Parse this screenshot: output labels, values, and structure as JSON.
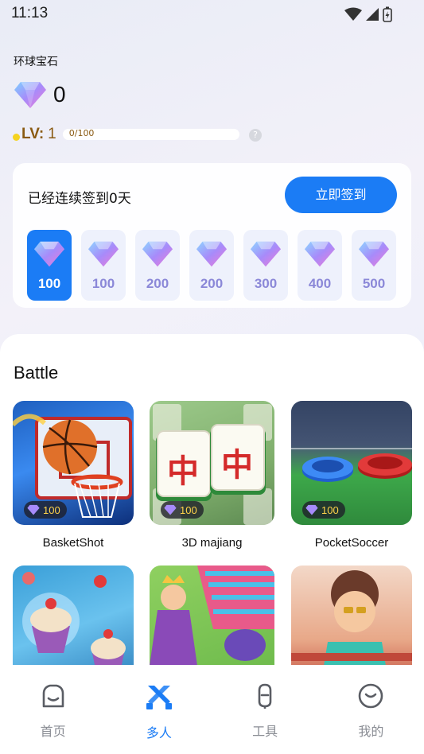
{
  "status_bar": {
    "time": "11:13"
  },
  "header": {
    "title": "环球宝石",
    "gem_count": "0",
    "level_label": "LV:",
    "level_value": "1",
    "progress_text": "0/100",
    "progress_fraction": 0,
    "help_label": "?"
  },
  "checkin": {
    "message": "已经连续签到0天",
    "button_label": "立即签到",
    "days": [
      {
        "reward": "100",
        "active": true
      },
      {
        "reward": "100",
        "active": false
      },
      {
        "reward": "200",
        "active": false
      },
      {
        "reward": "200",
        "active": false
      },
      {
        "reward": "300",
        "active": false
      },
      {
        "reward": "400",
        "active": false
      },
      {
        "reward": "500",
        "active": false
      }
    ]
  },
  "battle": {
    "title": "Battle",
    "games": [
      {
        "name": "BasketShot",
        "price": "100"
      },
      {
        "name": "3D majiang",
        "price": "100",
        "tile_text": "中"
      },
      {
        "name": "PocketSoccer",
        "price": "100"
      },
      {
        "name": "",
        "price": ""
      },
      {
        "name": "",
        "price": ""
      },
      {
        "name": "",
        "price": ""
      }
    ]
  },
  "nav": {
    "items": [
      {
        "label": "首页",
        "icon": "home-icon",
        "active": false
      },
      {
        "label": "多人",
        "icon": "battle-swords-icon",
        "active": true
      },
      {
        "label": "工具",
        "icon": "tools-icon",
        "active": false
      },
      {
        "label": "我的",
        "icon": "profile-smile-icon",
        "active": false
      }
    ]
  },
  "colors": {
    "accent": "#1b7cf5",
    "gem": "#8b7ef0",
    "level": "#8a5a12",
    "price": "#ffd34a"
  }
}
